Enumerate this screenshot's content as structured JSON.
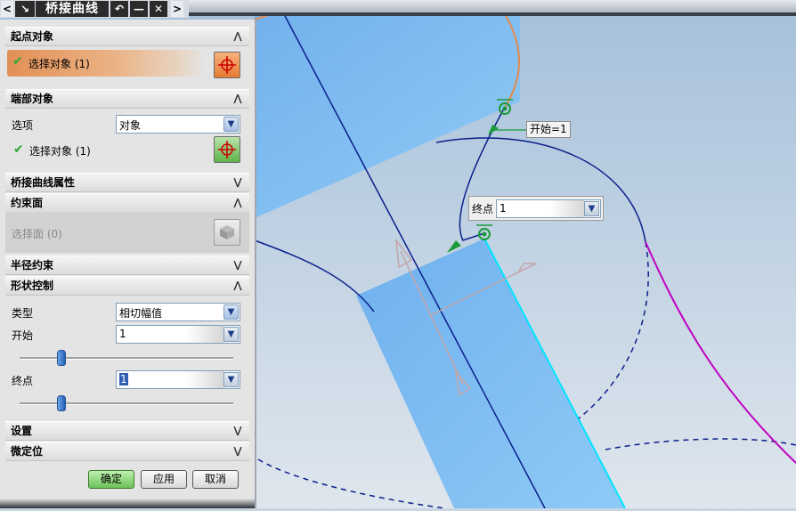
{
  "titlebar": {
    "title": "桥接曲线",
    "back_glyph": "<",
    "forward_glyph": ">",
    "undo_glyph": "↶",
    "minimize_glyph": "—",
    "close_glyph": "✕"
  },
  "sections": {
    "start_object": {
      "title": "起点对象",
      "select_label": "选择对象 (1)"
    },
    "end_object": {
      "title": "端部对象",
      "option_label": "选项",
      "option_value": "对象",
      "select_label": "选择对象 (1)"
    },
    "bridge_props": {
      "title": "桥接曲线属性"
    },
    "constraint_face": {
      "title": "约束面",
      "select_label": "选择面 (0)"
    },
    "radius_constraint": {
      "title": "半径约束"
    },
    "shape_control": {
      "title": "形状控制",
      "type_label": "类型",
      "type_value": "相切幅值",
      "start_label": "开始",
      "start_value": "1",
      "start_slider_fraction": 0.19,
      "end_label": "终点",
      "end_value": "1",
      "end_slider_fraction": 0.19
    },
    "settings": {
      "title": "设置"
    },
    "fine_position": {
      "title": "微定位"
    }
  },
  "buttons": {
    "ok": "确定",
    "apply": "应用",
    "cancel": "取消"
  },
  "viewport": {
    "start_label": "开始=1",
    "end_label": "终点",
    "end_input_value": "1"
  },
  "colors": {
    "accent_orange": "#e48a4c",
    "bridge_curve": "#0a1f8c",
    "magenta_curve": "#c000c0",
    "surface_blue": "#7cb6f0",
    "cyan_edge": "#00e5ff",
    "check_green": "#2ea836"
  }
}
